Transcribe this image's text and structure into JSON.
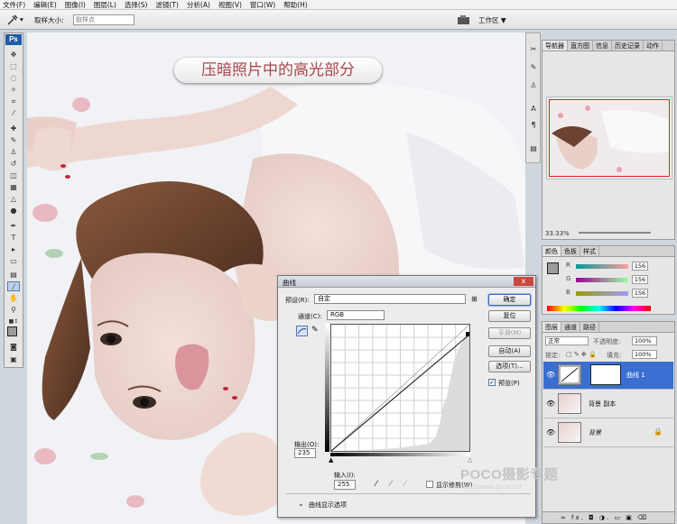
{
  "menubar": {
    "items": [
      "文件(F)",
      "编辑(E)",
      "图像(I)",
      "图层(L)",
      "选择(S)",
      "滤镜(T)",
      "分析(A)",
      "视图(V)",
      "窗口(W)",
      "帮助(H)"
    ]
  },
  "options": {
    "sample_size_label": "取样大小:",
    "sample_size_value": "取样点",
    "workspace_label": "工作区 ▼"
  },
  "toolbox": {
    "logo": "Ps"
  },
  "banner": {
    "text": "压暗照片中的高光部分"
  },
  "navigator": {
    "tabs": [
      "导航器",
      "直方图",
      "信息",
      "历史记录",
      "动作"
    ],
    "zoom": "33.33%"
  },
  "color_panel": {
    "tabs": [
      "颜色",
      "色板",
      "样式"
    ],
    "sliders": [
      {
        "letter": "R",
        "value": "156"
      },
      {
        "letter": "G",
        "value": "156"
      },
      {
        "letter": "B",
        "value": "156"
      }
    ]
  },
  "layers_panel": {
    "tabs": [
      "图层",
      "通道",
      "路径"
    ],
    "blend_mode": "正常",
    "opacity_label": "不透明度:",
    "opacity_value": "100%",
    "lock_label": "锁定:",
    "fill_label": "填充:",
    "fill_value": "100%",
    "layers": [
      {
        "name": "曲线 1",
        "selected": true
      },
      {
        "name": "背景 副本",
        "selected": false
      },
      {
        "name": "背景",
        "selected": false
      }
    ],
    "bottom_icons": "∞ fx. ◘ ◑. ▭ ▣ ⌫"
  },
  "curves_dialog": {
    "title": "曲线",
    "close": "x",
    "preset_label": "预设(R):",
    "preset_value": "自定",
    "channel_label": "通道(C):",
    "channel_value": "RGB",
    "output_label": "输出(O):",
    "output_value": "235",
    "input_label": "输入(I):",
    "input_value": "255",
    "show_clipping": "显示修剪(W)",
    "display_options": "曲线显示选项",
    "buttons": {
      "ok": "确定",
      "reset": "复位",
      "smooth": "平滑(M)",
      "auto": "自动(A)",
      "options": "选项(T)...",
      "preview": "预览(P)"
    }
  },
  "watermark": {
    "brand": "POCO摄影专题",
    "url": "http://photo.poco.cn/"
  },
  "colors": {
    "accent_blue": "#3a6ed1",
    "banner_text": "#a8454d",
    "close_red": "#c9493f"
  }
}
